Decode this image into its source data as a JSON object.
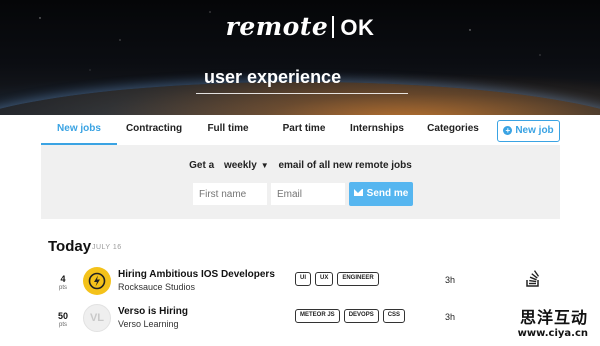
{
  "header": {
    "logo_left": "remote",
    "logo_right": "OK",
    "search_value": "user experience"
  },
  "nav": {
    "tabs": [
      {
        "label": "New jobs",
        "active": true
      },
      {
        "label": "Contracting",
        "active": false
      },
      {
        "label": "Full time",
        "active": false
      },
      {
        "label": "Part time",
        "active": false
      },
      {
        "label": "Internships",
        "active": false
      },
      {
        "label": "Categories",
        "active": false
      }
    ],
    "new_job_label": "New job"
  },
  "subscribe": {
    "prefix": "Get a",
    "frequency": "weekly",
    "suffix": "email of all new remote  jobs",
    "first_name_placeholder": "First name",
    "email_placeholder": "Email",
    "send_label": "Send me"
  },
  "listing": {
    "day": "Today",
    "date": "JULY 16",
    "jobs": [
      {
        "points": "4",
        "points_label": "pts",
        "title": "Hiring Ambitious IOS Developers",
        "company": "Rocksauce Studios",
        "tags": [
          "UI",
          "UX",
          "ENGINEER"
        ],
        "age": "3h",
        "avatar_icon": "lightning-icon"
      },
      {
        "points": "50",
        "points_label": "pts",
        "title": "Verso is Hiring",
        "company": "Verso Learning",
        "avatar_text": "VL",
        "tags": [
          "METEOR JS",
          "DEVOPS",
          "CSS"
        ],
        "age": "3h"
      }
    ]
  },
  "watermark": {
    "cn": "思洋互动",
    "url": "www.ciya.cn"
  },
  "colors": {
    "accent": "#3aa3e3",
    "send_button": "#56b6f0",
    "avatar_yellow": "#f4c21a"
  }
}
